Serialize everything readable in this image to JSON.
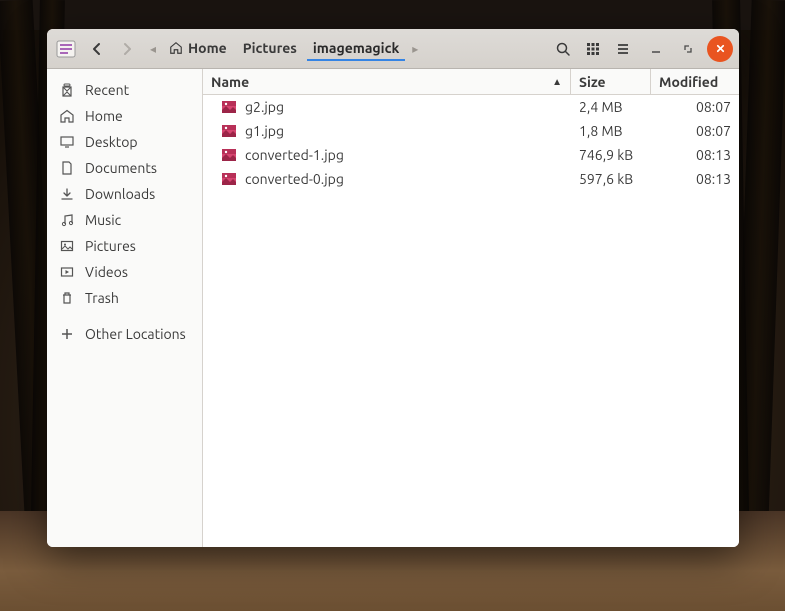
{
  "breadcrumb": [
    {
      "label": "Home",
      "has_icon": true
    },
    {
      "label": "Pictures",
      "has_icon": false
    },
    {
      "label": "imagemagick",
      "has_icon": false
    }
  ],
  "columns": {
    "name": "Name",
    "size": "Size",
    "modified": "Modified"
  },
  "sidebar": {
    "places": [
      {
        "label": "Recent",
        "icon": "clock"
      },
      {
        "label": "Home",
        "icon": "home"
      },
      {
        "label": "Desktop",
        "icon": "desktop"
      },
      {
        "label": "Documents",
        "icon": "document"
      },
      {
        "label": "Downloads",
        "icon": "download"
      },
      {
        "label": "Music",
        "icon": "music"
      },
      {
        "label": "Pictures",
        "icon": "picture"
      },
      {
        "label": "Videos",
        "icon": "video"
      },
      {
        "label": "Trash",
        "icon": "trash"
      }
    ],
    "other": {
      "label": "Other Locations",
      "icon": "plus"
    }
  },
  "files": [
    {
      "name": "g2.jpg",
      "size": "2,4 MB",
      "modified": "08:07"
    },
    {
      "name": "g1.jpg",
      "size": "1,8 MB",
      "modified": "08:07"
    },
    {
      "name": "converted-1.jpg",
      "size": "746,9 kB",
      "modified": "08:13"
    },
    {
      "name": "converted-0.jpg",
      "size": "597,6 kB",
      "modified": "08:13"
    }
  ]
}
